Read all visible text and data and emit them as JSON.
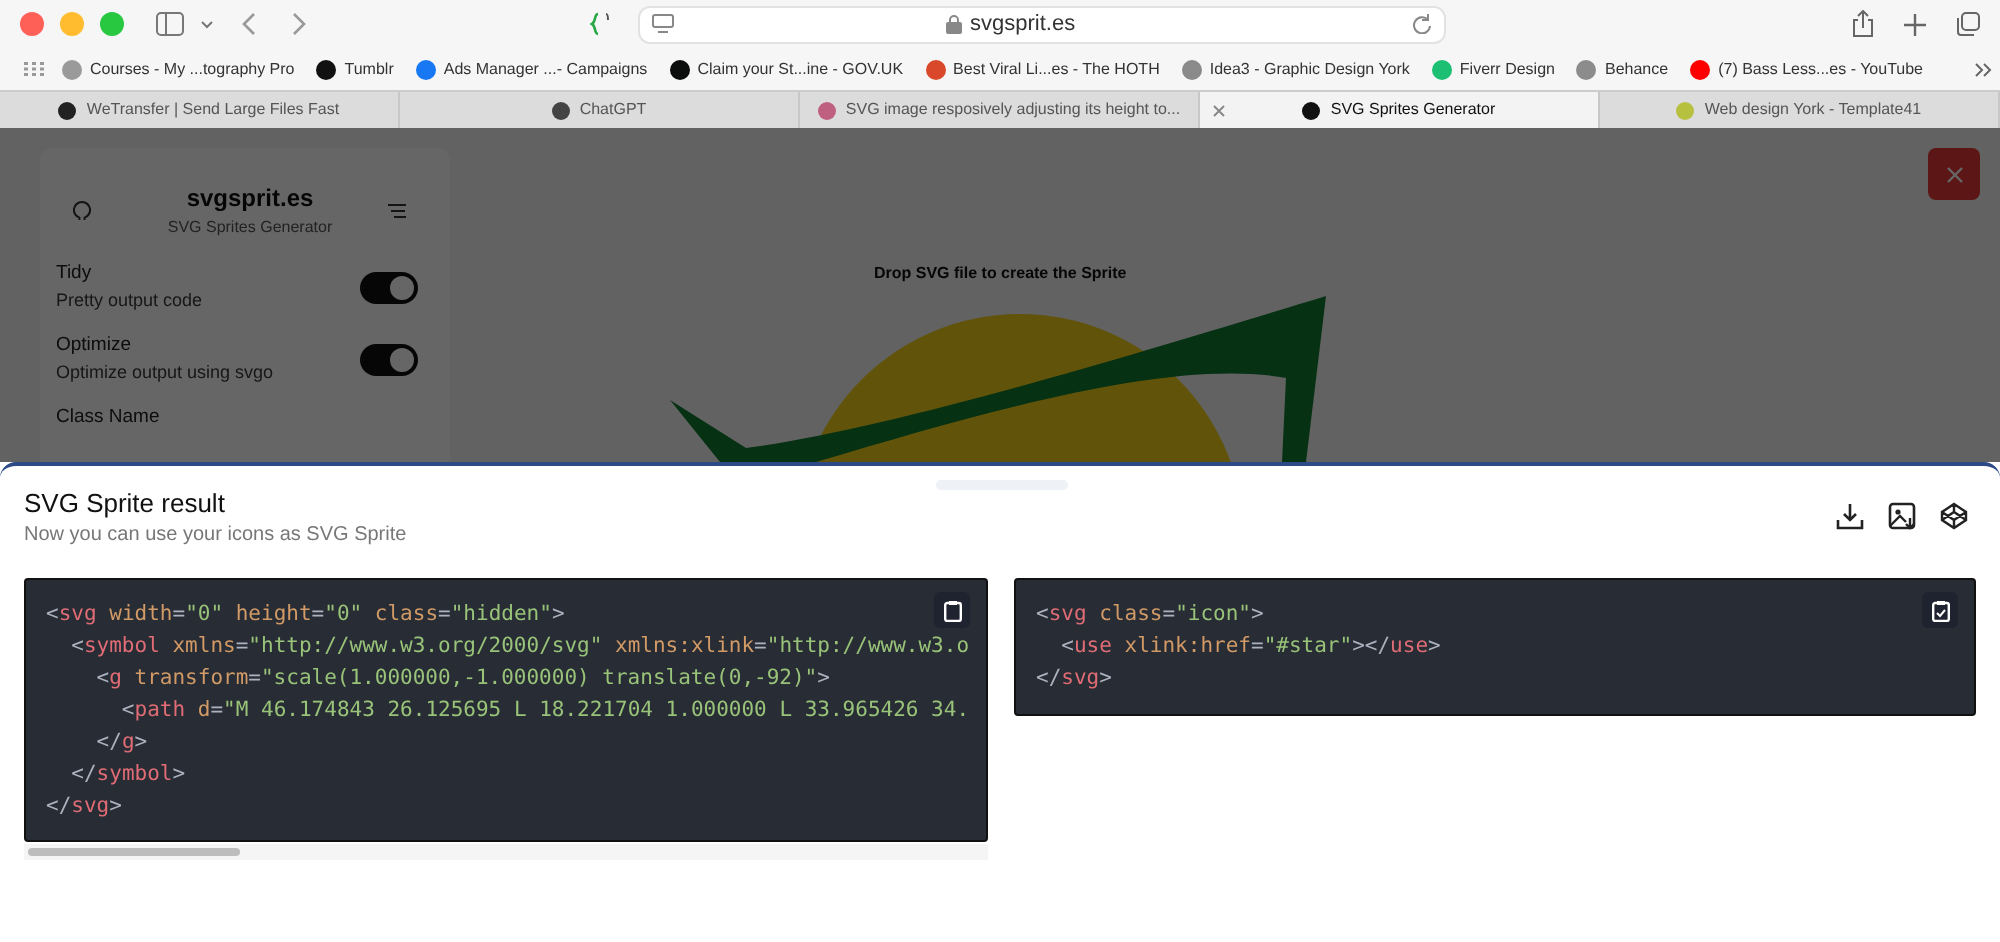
{
  "browser": {
    "address": "svgsprit.es",
    "bookmarks": [
      {
        "label": "Courses - My ...tography Pro",
        "color": "#9a9a9a"
      },
      {
        "label": "Tumblr",
        "color": "#111111"
      },
      {
        "label": "Ads Manager ...- Campaigns",
        "color": "#1877f2"
      },
      {
        "label": "Claim your St...ine - GOV.UK",
        "color": "#0b0c0c"
      },
      {
        "label": "Best Viral Li...es - The HOTH",
        "color": "#d9482b"
      },
      {
        "label": "Idea3 - Graphic Design York",
        "color": "#8a8a8a"
      },
      {
        "label": "Fiverr Design",
        "color": "#1dbf73"
      },
      {
        "label": "Behance",
        "color": "#8c8c8c"
      },
      {
        "label": "(7) Bass Less...es - YouTube",
        "color": "#ff0000"
      }
    ],
    "tabs": [
      {
        "label": "WeTransfer | Send Large Files Fast",
        "color": "#222222",
        "selected": false
      },
      {
        "label": "ChatGPT",
        "color": "#444444",
        "selected": false
      },
      {
        "label": "SVG image resposively adjusting its height to...",
        "color": "#c06080",
        "selected": false
      },
      {
        "label": "SVG Sprites Generator",
        "color": "#111111",
        "selected": true
      },
      {
        "label": "Web design York - Template41",
        "color": "#b8c040",
        "selected": false
      }
    ]
  },
  "page": {
    "sidebar": {
      "title": "svgsprit.es",
      "subtitle": "SVG Sprites Generator",
      "options": [
        {
          "label": "Tidy",
          "description": "Pretty output code",
          "on": true
        },
        {
          "label": "Optimize",
          "description": "Optimize output using svgo",
          "on": true
        }
      ],
      "field_label": "Class Name"
    },
    "dropzone": {
      "text": "Drop SVG file to create the Sprite"
    }
  },
  "sheet": {
    "title": "SVG Sprite result",
    "subtitle": "Now you can use your icons as SVG Sprite",
    "code_blocks": [
      {
        "copied": false,
        "lines": [
          [
            {
              "kind": "punct",
              "text": "<"
            },
            {
              "kind": "tag",
              "text": "svg"
            },
            {
              "kind": "attr",
              "text": " width"
            },
            {
              "kind": "punct",
              "text": "="
            },
            {
              "kind": "str",
              "text": "\"0\""
            },
            {
              "kind": "attr",
              "text": " height"
            },
            {
              "kind": "punct",
              "text": "="
            },
            {
              "kind": "str",
              "text": "\"0\""
            },
            {
              "kind": "attr",
              "text": " class"
            },
            {
              "kind": "punct",
              "text": "="
            },
            {
              "kind": "str",
              "text": "\"hidden\""
            },
            {
              "kind": "punct",
              "text": ">"
            }
          ],
          [
            {
              "kind": "punct",
              "text": "  <"
            },
            {
              "kind": "tag",
              "text": "symbol"
            },
            {
              "kind": "attr",
              "text": " xmlns"
            },
            {
              "kind": "punct",
              "text": "="
            },
            {
              "kind": "str",
              "text": "\"http://www.w3.org/2000/svg\""
            },
            {
              "kind": "attr",
              "text": " xmlns:xlink"
            },
            {
              "kind": "punct",
              "text": "="
            },
            {
              "kind": "str",
              "text": "\"http://www.w3.o"
            }
          ],
          [
            {
              "kind": "punct",
              "text": "    <"
            },
            {
              "kind": "tag",
              "text": "g"
            },
            {
              "kind": "attr",
              "text": " transform"
            },
            {
              "kind": "punct",
              "text": "="
            },
            {
              "kind": "str",
              "text": "\"scale(1.000000,-1.000000) translate(0,-92)\""
            },
            {
              "kind": "punct",
              "text": ">"
            }
          ],
          [
            {
              "kind": "punct",
              "text": "      <"
            },
            {
              "kind": "tag",
              "text": "path"
            },
            {
              "kind": "attr",
              "text": " d"
            },
            {
              "kind": "punct",
              "text": "="
            },
            {
              "kind": "str",
              "text": "\"M 46.174843 26.125695 L 18.221704 1.000000 L 33.965426 34."
            }
          ],
          [
            {
              "kind": "punct",
              "text": "    </"
            },
            {
              "kind": "tag",
              "text": "g"
            },
            {
              "kind": "punct",
              "text": ">"
            }
          ],
          [
            {
              "kind": "punct",
              "text": "  </"
            },
            {
              "kind": "tag",
              "text": "symbol"
            },
            {
              "kind": "punct",
              "text": ">"
            }
          ],
          [
            {
              "kind": "punct",
              "text": "</"
            },
            {
              "kind": "tag",
              "text": "svg"
            },
            {
              "kind": "punct",
              "text": ">"
            }
          ]
        ]
      },
      {
        "copied": true,
        "lines": [
          [
            {
              "kind": "punct",
              "text": "<"
            },
            {
              "kind": "tag",
              "text": "svg"
            },
            {
              "kind": "attr",
              "text": " class"
            },
            {
              "kind": "punct",
              "text": "="
            },
            {
              "kind": "str",
              "text": "\"icon\""
            },
            {
              "kind": "punct",
              "text": ">"
            }
          ],
          [
            {
              "kind": "punct",
              "text": "  <"
            },
            {
              "kind": "tag",
              "text": "use"
            },
            {
              "kind": "attr",
              "text": " xlink:href"
            },
            {
              "kind": "punct",
              "text": "="
            },
            {
              "kind": "str",
              "text": "\"#star\""
            },
            {
              "kind": "punct",
              "text": "></"
            },
            {
              "kind": "tag",
              "text": "use"
            },
            {
              "kind": "punct",
              "text": ">"
            }
          ],
          [
            {
              "kind": "punct",
              "text": "</"
            },
            {
              "kind": "tag",
              "text": "svg"
            },
            {
              "kind": "punct",
              "text": ">"
            }
          ]
        ]
      }
    ]
  }
}
